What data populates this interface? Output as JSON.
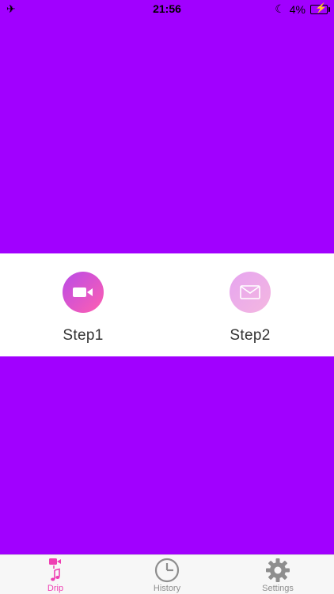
{
  "status_bar": {
    "time": "21:56",
    "battery_percent": "4%",
    "left_icon": "airplane-icon",
    "moon_icon": "moon-icon"
  },
  "steps": [
    {
      "label": "Step1",
      "icon": "video-camera-icon",
      "state": "active"
    },
    {
      "label": "Step2",
      "icon": "envelope-icon",
      "state": "inactive"
    }
  ],
  "tab_bar": {
    "tabs": [
      {
        "label": "Drip",
        "icon": "drip-icon",
        "selected": true
      },
      {
        "label": "History",
        "icon": "clock-icon",
        "selected": false
      },
      {
        "label": "Settings",
        "icon": "gear-icon",
        "selected": false
      }
    ]
  },
  "colors": {
    "background": "#a100ff",
    "accent": "#ee3fb3",
    "panel": "#ffffff"
  }
}
